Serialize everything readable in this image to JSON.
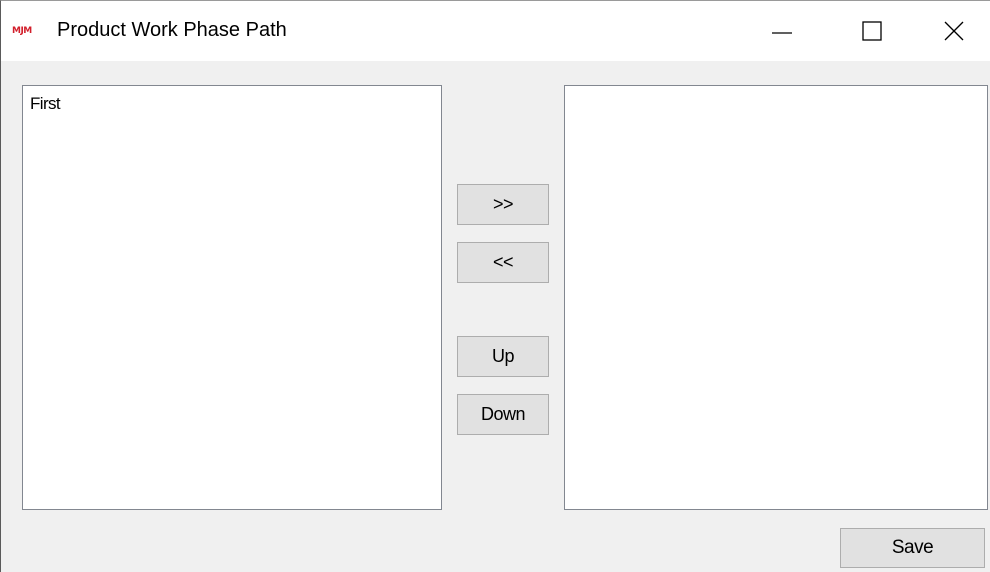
{
  "window": {
    "app_icon_text": "MJM",
    "title": "Product Work Phase Path",
    "controls": {
      "minimize_icon": "minimize-icon",
      "maximize_icon": "maximize-icon",
      "close_icon": "close-icon"
    }
  },
  "left_list": {
    "items": [
      "First"
    ]
  },
  "right_list": {
    "items": []
  },
  "buttons": {
    "add": ">>",
    "remove": "<<",
    "up": "Up",
    "down": "Down",
    "save": "Save"
  },
  "colors": {
    "icon_red": "#d21f2b",
    "window_bg": "#f0f0f0",
    "button_bg": "#e1e1e1",
    "button_border": "#adadad"
  }
}
